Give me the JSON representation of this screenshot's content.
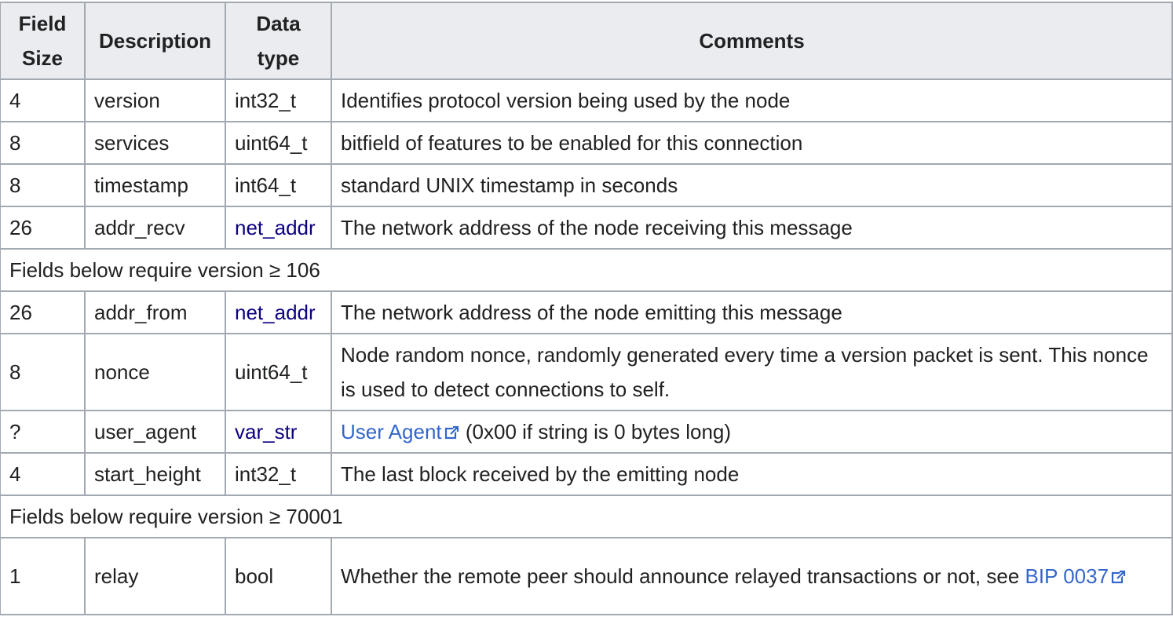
{
  "headers": {
    "field_size": "Field Size",
    "description": "Description",
    "data_type": "Data type",
    "comments": "Comments"
  },
  "rows": [
    {
      "size": "4",
      "desc": "version",
      "type": "int32_t",
      "comment": "Identifies protocol version being used by the node"
    },
    {
      "size": "8",
      "desc": "services",
      "type": "uint64_t",
      "comment": "bitfield of features to be enabled for this connection"
    },
    {
      "size": "8",
      "desc": "timestamp",
      "type": "int64_t",
      "comment": "standard UNIX timestamp in seconds"
    },
    {
      "size": "26",
      "desc": "addr_recv",
      "type": "net_addr",
      "comment": "The network address of the node receiving this message"
    },
    {
      "section": "Fields below require version ≥ 106"
    },
    {
      "size": "26",
      "desc": "addr_from",
      "type": "net_addr",
      "comment": "The network address of the node emitting this message"
    },
    {
      "size": "8",
      "desc": "nonce",
      "type": "uint64_t",
      "comment": "Node random nonce, randomly generated every time a version packet is sent. This nonce is used to detect connections to self."
    },
    {
      "size": "?",
      "desc": "user_agent",
      "type": "var_str",
      "comment_link": "User Agent",
      "comment_after": " (0x00 if string is 0 bytes long)"
    },
    {
      "size": "4",
      "desc": "start_height",
      "type": "int32_t",
      "comment": "The last block received by the emitting node"
    },
    {
      "section": "Fields below require version ≥ 70001"
    },
    {
      "size": "1",
      "desc": "relay",
      "type": "bool",
      "comment_before": "Whether the remote peer should announce relayed transactions or not, see ",
      "comment_link": "BIP 0037"
    }
  ],
  "icons": {
    "external_link": "external-link-icon"
  },
  "colors": {
    "header_bg": "#eaecf0",
    "border": "#a2a9b1",
    "text": "#202122",
    "internal_link": "#0b0080",
    "external_link": "#3366cc"
  }
}
